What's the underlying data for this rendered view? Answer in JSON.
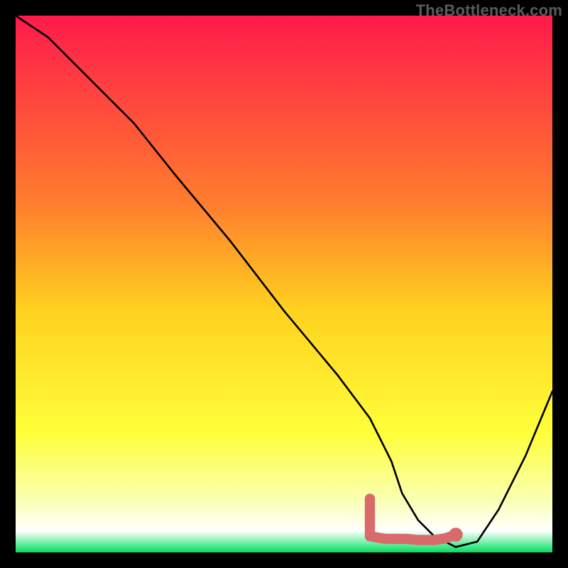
{
  "watermark": "TheBottleneck.com",
  "chart_data": {
    "type": "line",
    "title": "",
    "xlabel": "",
    "ylabel": "",
    "xlim": [
      0,
      100
    ],
    "ylim": [
      0,
      100
    ],
    "gradient_stops": [
      {
        "offset": 0,
        "color": "#ff1a4b"
      },
      {
        "offset": 35,
        "color": "#ff7d2e"
      },
      {
        "offset": 55,
        "color": "#ffd21f"
      },
      {
        "offset": 78,
        "color": "#ffff3a"
      },
      {
        "offset": 90,
        "color": "#faffb0"
      },
      {
        "offset": 96,
        "color": "#ffffff"
      },
      {
        "offset": 100,
        "color": "#00e060"
      }
    ],
    "series": [
      {
        "name": "bottleneck-curve",
        "color": "#000000",
        "x": [
          0,
          6,
          22,
          30,
          40,
          50,
          60,
          66,
          70,
          72,
          75,
          78,
          82,
          86,
          90,
          95,
          100
        ],
        "y": [
          100,
          96,
          80,
          70,
          58,
          45,
          33,
          25,
          17,
          11,
          6,
          3,
          1,
          2,
          8,
          18,
          30
        ]
      }
    ],
    "highlight_zone": {
      "name": "optimal-range",
      "color": "#d86a6a",
      "points": [
        {
          "x": 66,
          "y": 10
        },
        {
          "x": 66,
          "y": 3
        },
        {
          "x": 69,
          "y": 2.5
        },
        {
          "x": 73,
          "y": 2.5
        },
        {
          "x": 75,
          "y": 2.3
        },
        {
          "x": 78,
          "y": 2.3
        },
        {
          "x": 80,
          "y": 2.6
        },
        {
          "x": 82,
          "y": 3.3
        }
      ],
      "dot": {
        "x": 82,
        "y": 3.3,
        "r": 1.3
      }
    }
  }
}
